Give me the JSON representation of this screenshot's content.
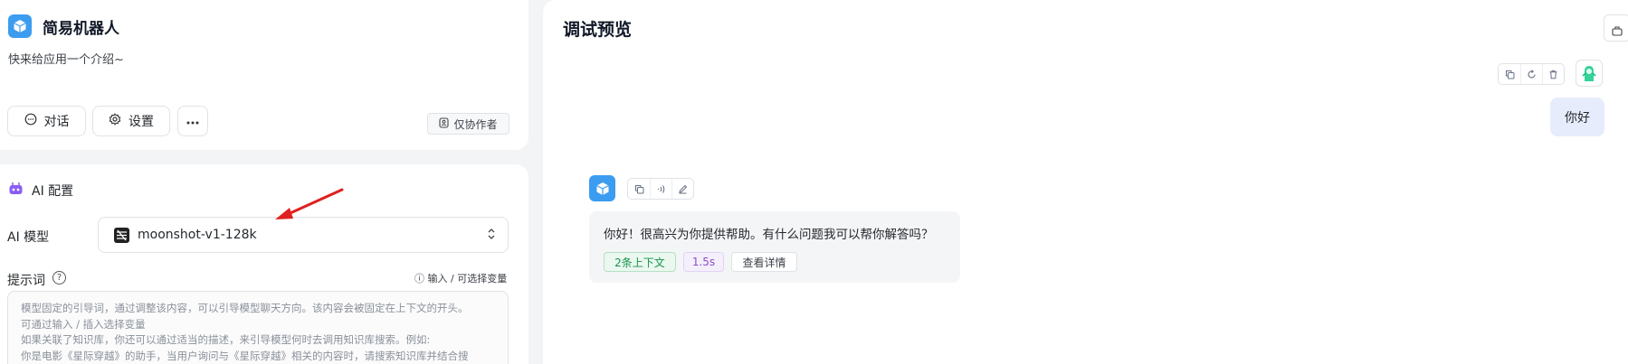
{
  "app": {
    "name": "简易机器人",
    "intro": "快来给应用一个介绍~",
    "buttons": {
      "chat": "对话",
      "settings": "设置"
    },
    "author_badge": "仅协作者"
  },
  "config": {
    "section_title": "AI 配置",
    "model_label": "AI 模型",
    "model_value": "moonshot-v1-128k",
    "prompt_label": "提示词",
    "prompt_hint": "输入 / 可选择变量",
    "prompt_placeholder_lines": [
      "模型固定的引导词，通过调整该内容，可以引导模型聊天方向。该内容会被固定在上下文的开头。",
      "可通过输入 / 插入选择变量",
      "如果关联了知识库，你还可以通过适当的描述，来引导模型何时去调用知识库搜索。例如:",
      "你是电影《星际穿越》的助手，当用户询问与《星际穿越》相关的内容时，请搜索知识库并结合搜"
    ]
  },
  "preview": {
    "title": "调试预览",
    "user_message": "你好",
    "bot_message": "你好！很高兴为你提供帮助。有什么问题我可以帮你解答吗？",
    "chips": {
      "context": "2条上下文",
      "time": "1.5s",
      "detail": "查看详情"
    }
  },
  "colors": {
    "accent": "#3b9cf0",
    "annotation_arrow": "#e02020"
  },
  "icons": [
    "cube-logo-icon",
    "chat-icon",
    "gear-icon",
    "more-icon",
    "collaborator-icon",
    "robot-icon",
    "moonshot-logo-icon",
    "help-icon",
    "info-icon",
    "copy-icon",
    "refresh-icon",
    "delete-icon",
    "speaker-icon",
    "edit-icon",
    "user-avatar-icon",
    "sidebar-toggle-icon"
  ]
}
